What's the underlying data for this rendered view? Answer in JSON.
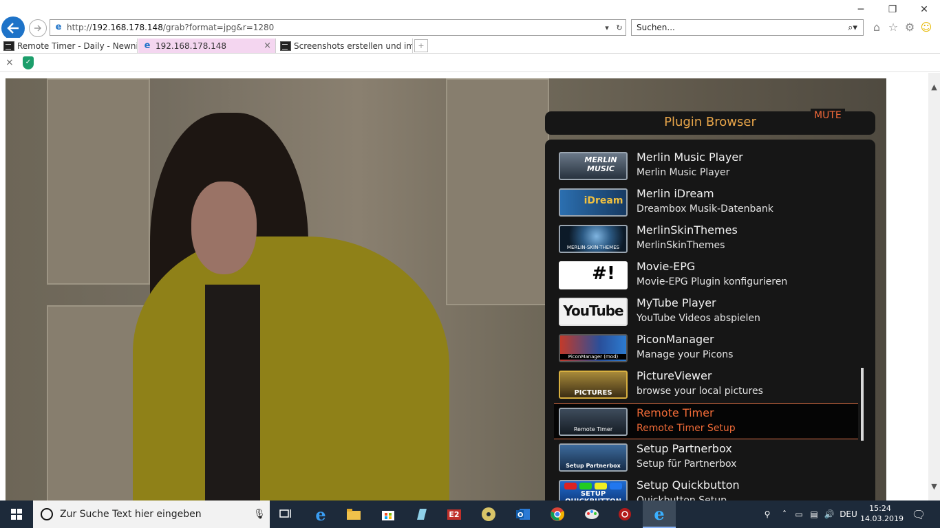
{
  "browser": {
    "address_url_prefix": "http://",
    "address_url_host": "192.168.178.148",
    "address_url_path": "/grab?format=jpg&r=1280",
    "search_placeholder": "Suchen...",
    "window_controls": {
      "minimize": "─",
      "restore": "❐",
      "close": "✕"
    },
    "tabs": [
      {
        "title": "Remote Timer - Daily - Newni...",
        "icon": "tv-icon"
      },
      {
        "title": "192.168.178.148",
        "icon": "ie-icon",
        "close": "×"
      },
      {
        "title": "Screenshots erstellen und im B...",
        "icon": "tv-icon"
      }
    ],
    "favbar_close": "×"
  },
  "plugin_browser": {
    "title": "Plugin Browser",
    "mute": "MUTE",
    "items": [
      {
        "name": "Merlin Music Player",
        "desc": "Merlin Music Player",
        "thumb": "MERLIN MUSIC"
      },
      {
        "name": "Merlin iDream",
        "desc": "Dreambox Musik-Datenbank",
        "thumb": "iDream"
      },
      {
        "name": "MerlinSkinThemes",
        "desc": "MerlinSkinThemes",
        "thumb": "MERLIN-SKIN-THEMES"
      },
      {
        "name": "Movie-EPG",
        "desc": "Movie-EPG Plugin konfigurieren",
        "thumb": "#!"
      },
      {
        "name": "MyTube Player",
        "desc": "YouTube Videos abspielen",
        "thumb": "YouTube"
      },
      {
        "name": "PiconManager",
        "desc": "Manage your Picons",
        "thumb": "PiconManager (mod)"
      },
      {
        "name": "PictureViewer",
        "desc": "browse your local pictures",
        "thumb": "PICTURES"
      },
      {
        "name": "Remote Timer",
        "desc": "Remote Timer Setup",
        "thumb": "Remote Timer"
      },
      {
        "name": "Setup Partnerbox",
        "desc": "Setup für Partnerbox",
        "thumb": "Setup Partnerbox"
      },
      {
        "name": "Setup Quickbutton",
        "desc": "Quickbutton Setup",
        "thumb": "SETUP QUICKBUTTON"
      }
    ],
    "selected_index": 7
  },
  "taskbar": {
    "search_placeholder": "Zur Suche Text hier eingeben",
    "language": "DEU",
    "time": "15:24",
    "date": "14.03.2019"
  },
  "colors": {
    "accent_orange": "#ef6a37",
    "title_gold": "#e9a64a",
    "ie_blue": "#1e73c8"
  }
}
